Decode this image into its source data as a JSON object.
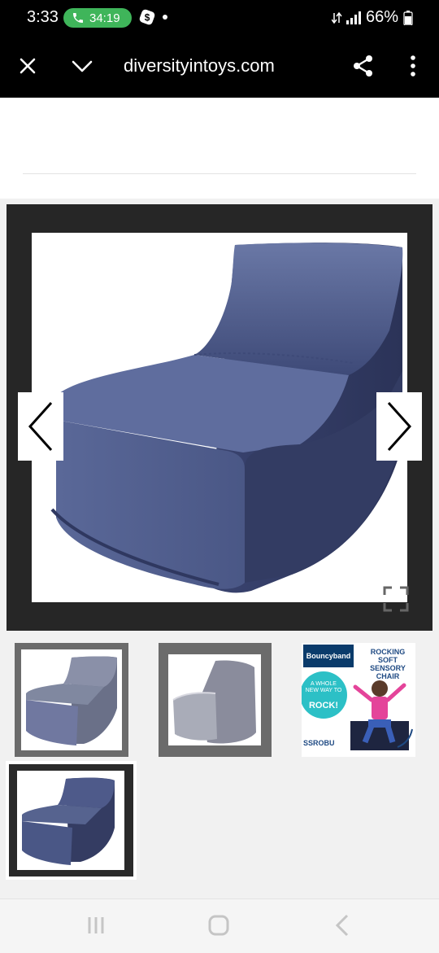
{
  "status_bar": {
    "time": "3:33",
    "call_duration": "34:19",
    "battery_percent": "66%"
  },
  "browser": {
    "url": "diversityintoys.com",
    "close_icon": "close-icon",
    "collapse_icon": "chevron-down-icon",
    "share_icon": "share-icon",
    "menu_icon": "more-vertical-icon"
  },
  "gallery": {
    "main_image_alt": "rocking chair",
    "selected_index": 4,
    "thumbnail_count": 4
  },
  "ad_thumbnail": {
    "brand": "Bouncyband",
    "title": "ROCKING SOFT SENSORY CHAIR",
    "tagline": "A WHOLE NEW WAY TO",
    "tagline_emphasis": "ROCK!",
    "sku": "SSROBU"
  },
  "colors": {
    "chair": "#4a5786",
    "accent_call": "#3fb55a",
    "ad_teal": "#2cc0c6",
    "ad_navy": "#0a3b6b"
  }
}
